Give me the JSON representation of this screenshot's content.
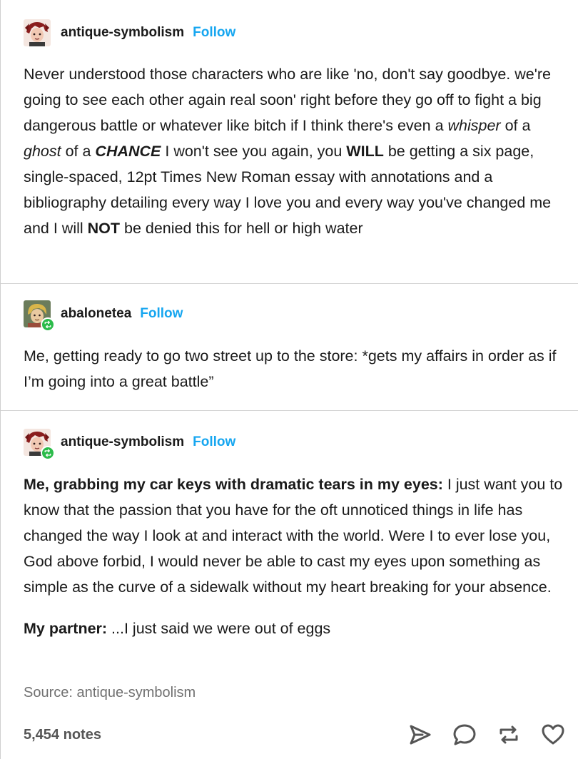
{
  "posts": [
    {
      "username": "antique-symbolism",
      "follow_label": "Follow",
      "avatar_icon": "avatar-red-hair-icon",
      "text_runs": [
        {
          "t": "Never understood those characters who are like 'no, don't say goodbye. we're going to see each other again real soon' right before they go off to fight a big dangerous battle or whatever like bitch if I think there's even a "
        },
        {
          "t": "whisper",
          "i": true
        },
        {
          "t": " of a "
        },
        {
          "t": "ghost",
          "i": true
        },
        {
          "t": " of a "
        },
        {
          "t": "CHANCE",
          "i": true,
          "b": true
        },
        {
          "t": " I won't see you again, you "
        },
        {
          "t": "WILL",
          "b": true
        },
        {
          "t": " be getting a six page, single-spaced, 12pt Times New Roman essay with annotations and a bibliography detailing every way I love you and every way you've changed me and I will "
        },
        {
          "t": "NOT",
          "b": true
        },
        {
          "t": " be denied this for hell or high water"
        }
      ]
    },
    {
      "username": "abalonetea",
      "follow_label": "Follow",
      "avatar_icon": "avatar-blond-character-icon",
      "text_runs": [
        {
          "t": "Me, getting ready to go two street up to the store: *gets my affairs in order as if I’m going into a great battle”"
        }
      ]
    },
    {
      "username": "antique-symbolism",
      "follow_label": "Follow",
      "avatar_icon": "avatar-red-hair-icon",
      "paragraphs": [
        [
          {
            "t": "Me, grabbing my car keys with dramatic tears in my eyes:",
            "b": true
          },
          {
            "t": " I just want you to know that the passion that you have for the oft unnoticed things in life has changed the way I look at and interact with the world. Were I to ever lose you, God above forbid, I would never be able to cast my eyes upon something as simple as the curve of a sidewalk without my heart breaking for your absence."
          }
        ],
        [
          {
            "t": "My partner:",
            "b": true
          },
          {
            "t": " ...I just said we were out of eggs"
          }
        ]
      ]
    }
  ],
  "source_text": "Source: antique-symbolism",
  "notes_count": "5,454 notes",
  "actions": [
    "share-icon",
    "reply-icon",
    "reblog-icon",
    "like-icon"
  ],
  "colors": {
    "follow": "#16a6f0",
    "reblog_badge": "#2bbb4a",
    "divider": "#d4d4d4",
    "muted": "#707070"
  }
}
